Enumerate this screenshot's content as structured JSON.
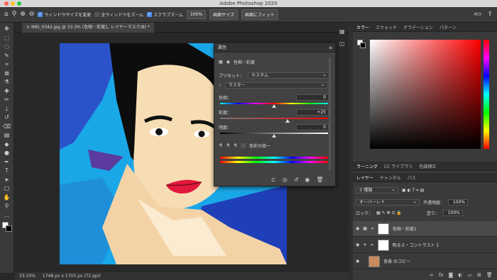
{
  "window": {
    "title": "Adobe Photoshop 2020"
  },
  "options": {
    "resize_windows": "ウィンドウサイズを変更",
    "zoom_all": "全ウィンドウをズーム",
    "scrubby_zoom": "スクラブズーム",
    "zoom_value": "100%",
    "fit_screen": "画面サイズ",
    "fill_screen": "画面にフィット"
  },
  "document": {
    "tab": "IMG_0342.jpg @ 33.3% (色相・彩度1, レイヤーマスク/8) *"
  },
  "status": {
    "zoom": "33.33%",
    "info": "1748 px x 1703 px (72 ppi)"
  },
  "properties": {
    "title": "属性",
    "type": "色相・彩度",
    "preset_label": "プリセット：",
    "preset_value": "カスタム",
    "range": "マスター",
    "hue_label": "色相：",
    "hue_value": "0",
    "sat_label": "彩度：",
    "sat_value": "+25",
    "light_label": "明度：",
    "light_value": "0",
    "colorize": "色彩の統一",
    "hue_pos": 0.5,
    "sat_pos": 0.625,
    "light_pos": 0.5
  },
  "color_panel": {
    "tabs": [
      "カラー",
      "スウォッチ",
      "グラデーション",
      "パターン"
    ],
    "accent": "#ff0000"
  },
  "learn_panel": {
    "tabs": [
      "ラーニング",
      "CC ライブラリ",
      "色調補正"
    ]
  },
  "layers_panel": {
    "tabs": [
      "レイヤー",
      "チャンネル",
      "パス"
    ],
    "filter": "種類",
    "blend": "オーバーレイ",
    "opacity_label": "不透明度：",
    "opacity": "100%",
    "lock_label": "ロック：",
    "fill_label": "塗り：",
    "fill": "100%",
    "layers": [
      {
        "name": "色相・彩度1"
      },
      {
        "name": "明るさ・コントラスト 1"
      },
      {
        "name": "背景 のコピー"
      }
    ]
  }
}
